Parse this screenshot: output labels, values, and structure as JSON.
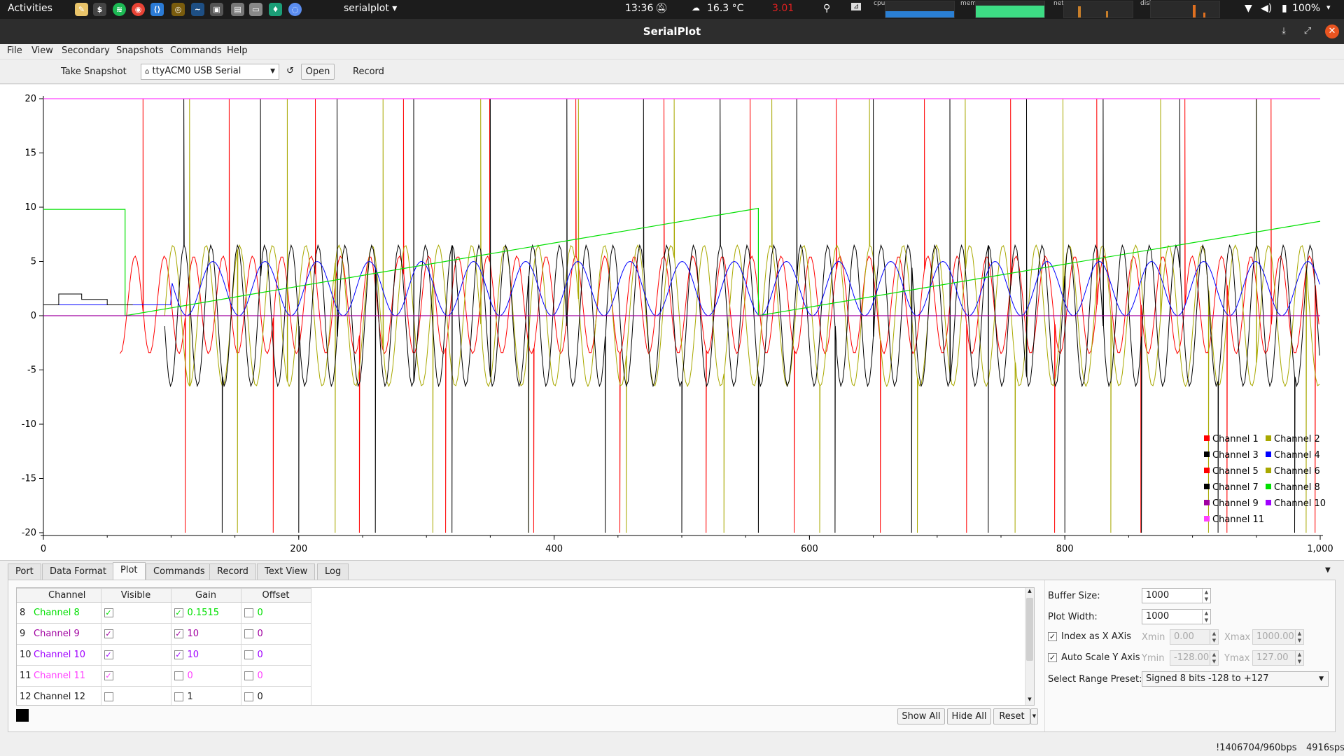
{
  "topbar": {
    "activities": "Activities",
    "app_menu": "serialplot",
    "clock": "13:36",
    "weather": "16.3 °C",
    "net_rate": "3.01",
    "battery": "100%",
    "monitor_labels": [
      "cpu",
      "mem",
      "net",
      "disk"
    ]
  },
  "window": {
    "title": "SerialPlot"
  },
  "menu": [
    "File",
    "View",
    "Secondary",
    "Snapshots",
    "Commands",
    "Help"
  ],
  "toolbar": {
    "snapshot": "Take Snapshot",
    "port": "ttyACM0 USB Serial",
    "open": "Open",
    "record": "Record"
  },
  "colors": {
    "ch1": "#ff0000",
    "ch2": "#a8a800",
    "ch3": "#000000",
    "ch4": "#0000ff",
    "ch5": "#ff0000",
    "ch6": "#a8a800",
    "ch7": "#000000",
    "ch8": "#00e000",
    "ch9": "#a000a0",
    "ch10": "#a000ff",
    "ch11": "#ff40ff"
  },
  "chart_data": {
    "type": "line",
    "xlim": [
      0,
      1000
    ],
    "ylim": [
      -20,
      20
    ],
    "x_ticks": [
      "0",
      "200",
      "400",
      "600",
      "800",
      "1,000"
    ],
    "y_ticks": [
      "20",
      "15",
      "10",
      "5",
      "0",
      "-5",
      "-10",
      "-15",
      "-20"
    ],
    "legend": [
      "Channel 1",
      "Channel 2",
      "Channel 3",
      "Channel 4",
      "Channel 5",
      "Channel 6",
      "Channel 7",
      "Channel 8",
      "Channel 9",
      "Channel 10",
      "Channel 11"
    ],
    "legend_position": "bottom-right",
    "series": [
      {
        "name": "Channel 1",
        "pattern": "square wave about 0, amplitude ~3-5, with spikes to +20 and -20"
      },
      {
        "name": "Channel 2",
        "pattern": "triangle-like oscillation, amplitude ~7, with spikes"
      },
      {
        "name": "Channel 3",
        "pattern": "oscillation amplitude ~7, with spikes to ±20"
      },
      {
        "name": "Channel 4",
        "pattern": "fast oscillation between 0 and ~5"
      },
      {
        "name": "Channel 8",
        "points": [
          [
            0,
            9.8
          ],
          [
            64,
            9.8
          ],
          [
            64,
            0
          ],
          [
            560,
            9.9
          ],
          [
            560,
            0
          ],
          [
            1000,
            8.7
          ]
        ]
      },
      {
        "name": "Channel 9",
        "points": [
          [
            0,
            0
          ],
          [
            1000,
            0
          ]
        ]
      },
      {
        "name": "Channel 11",
        "points": [
          [
            0,
            20
          ],
          [
            1000,
            20
          ]
        ]
      }
    ]
  },
  "tabs": [
    "Port",
    "Data Format",
    "Plot",
    "Commands",
    "Record",
    "Text View",
    "Log"
  ],
  "active_tab": "Plot",
  "table": {
    "headers": [
      "Channel",
      "Visible",
      "Gain",
      "Offset"
    ],
    "rows": [
      {
        "idx": "8",
        "name": "Channel 8",
        "visible": "✓",
        "gain_cb": "✓",
        "gain": "0.1515",
        "offset": "0"
      },
      {
        "idx": "9",
        "name": "Channel 9",
        "visible": "✓",
        "gain_cb": "✓",
        "gain": "10",
        "offset": "0"
      },
      {
        "idx": "10",
        "name": "Channel 10",
        "visible": "✓",
        "gain_cb": "✓",
        "gain": "10",
        "offset": "0"
      },
      {
        "idx": "11",
        "name": "Channel 11",
        "visible": "✓",
        "gain_cb": "",
        "gain": "0",
        "offset": "0"
      },
      {
        "idx": "12",
        "name": "Channel 12",
        "visible": "",
        "gain_cb": "",
        "gain": "1",
        "offset": "0"
      }
    ]
  },
  "buttons": {
    "show_all": "Show All",
    "hide_all": "Hide All",
    "reset": "Reset"
  },
  "settings": {
    "buffer_label": "Buffer Size:",
    "buffer": "1000",
    "width_label": "Plot Width:",
    "width": "1000",
    "index_x": "Index as X AXis",
    "xmin_l": "Xmin",
    "xmin": "0.00",
    "xmax_l": "Xmax",
    "xmax": "1000.00",
    "autoscale": "Auto Scale Y Axis",
    "ymin_l": "Ymin",
    "ymin": "-128.00",
    "ymax_l": "Ymax",
    "ymax": "127.00",
    "preset_label": "Select Range Preset:",
    "preset": "Signed 8 bits -128 to +127"
  },
  "status": {
    "bps": "!1406704/960bps",
    "sps": "4916sps"
  }
}
